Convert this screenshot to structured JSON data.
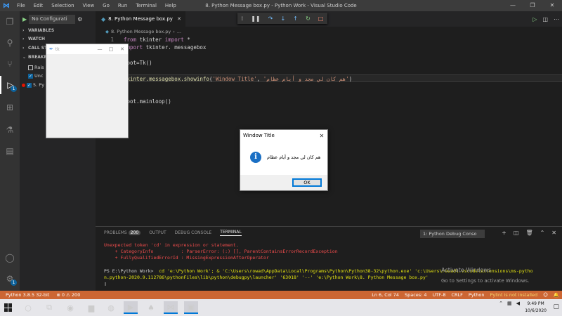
{
  "titlebar": {
    "menu": [
      "File",
      "Edit",
      "Selection",
      "View",
      "Go",
      "Run",
      "Terminal",
      "Help"
    ],
    "title": "8. Python Message box.py - Python Work - Visual Studio Code"
  },
  "activity": {
    "debug_badge": "1",
    "settings_badge": "1"
  },
  "sidebar": {
    "config": "No Configurati",
    "sections": {
      "variables": "VARIABLES",
      "watch": "WATCH",
      "callstack": "CALL STA",
      "breakpoints": "BREAKP"
    },
    "breakpoints": [
      {
        "label": "Rais",
        "checked": false
      },
      {
        "label": "Unc",
        "checked": true
      },
      {
        "label": "5. Py",
        "checked": true
      }
    ]
  },
  "editor": {
    "tab_label": "8. Python Message box.py",
    "breadcrumb_file": "8. Python Message box.py",
    "breadcrumb_more": "...",
    "lines": {
      "l1_num": "1",
      "l1_kw1": "from",
      "l1_mid": " tkinter ",
      "l1_kw2": "import",
      "l1_end": " *",
      "l2_kw": "import",
      "l2_rest": " tkinter. messagebox",
      "l4": "root=Tk()",
      "l6_fn": "tkinter.messagebox.showinfo",
      "l6_open": "(",
      "l6_str1": "'Window Title'",
      "l6_sep": ", ",
      "l6_str2": "'هم كان لي مجد و أيام عظام'",
      "l6_close": ")",
      "l8": "root.mainloop()"
    }
  },
  "tk_window": {
    "title": "tk"
  },
  "messagebox": {
    "title": "Window Title",
    "message": "هم كان لي مجد و أيام عظام",
    "ok": "OK"
  },
  "panel": {
    "tabs": {
      "problems": "PROBLEMS",
      "problems_count": "200",
      "output": "OUTPUT",
      "debug_console": "DEBUG CONSOLE",
      "terminal": "TERMINAL"
    },
    "terminal_select": "1: Python Debug Conso",
    "terminal": {
      "err1": "Unexpected token 'cd' in expression or statement.",
      "err2": "    + CategoryInfo          : ParserError: (:) [], ParentContainsErrorRecordException",
      "err3": "    + FullyQualifiedErrorId : MissingExpressionAfterOperator",
      "ps_prompt": "PS E:\\Python Work> ",
      "ps_cmd": " cd 'e:\\Python Work'; & 'C:\\Users\\rowad\\AppData\\Local\\Programs\\Python\\Python38-32\\python.exe' 'c:\\Users\\rowad\\.vscode\\extensions\\ms-pytho",
      "ps_cmd2": "n.python-2020.9.112786\\pythonFiles\\lib\\python\\debugpy\\launcher' '63018' '--' 'e:\\Python Work\\8. Python Message box.py'",
      "cursor": "▯"
    },
    "activate_title": "Activate Windows",
    "activate_sub": "Go to Settings to activate Windows."
  },
  "status": {
    "python": "Python 3.8.5 32-bit",
    "errors": "⊗ 0 ⚠ 200",
    "position": "Ln 6, Col 74",
    "spaces": "Spaces: 4",
    "encoding": "UTF-8",
    "eol": "CRLF",
    "language": "Python",
    "lint": "Pylint is not installed"
  },
  "taskbar": {
    "time": "9:49 PM",
    "date": "10/6/2020"
  },
  "colors": {
    "statusbar": "#cc6633",
    "accent": "#0078d7"
  }
}
